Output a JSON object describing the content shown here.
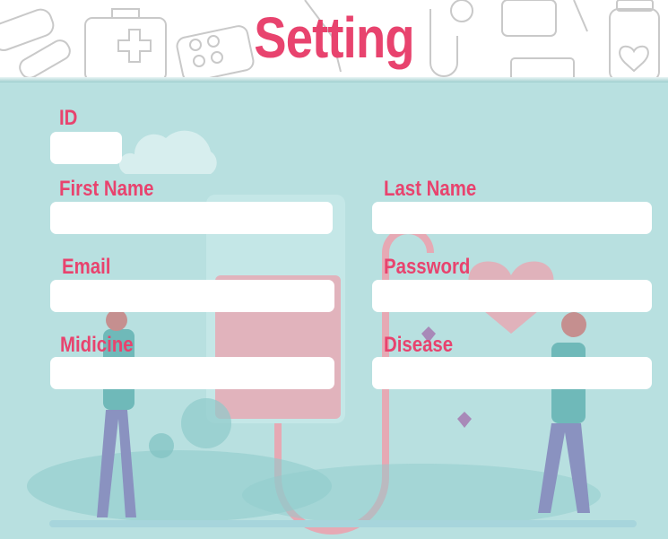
{
  "header": {
    "title": "Setting"
  },
  "form": {
    "id_label": "ID",
    "first_name_label": "First Name",
    "last_name_label": "Last Name",
    "email_label": "Email",
    "password_label": "Password",
    "medicine_label": "Midicine",
    "disease_label": "Disease",
    "id_value": "",
    "first_name_value": "",
    "last_name_value": "",
    "email_value": "",
    "password_value": "",
    "medicine_value": "",
    "disease_value": ""
  },
  "colors": {
    "accent": "#e8436e",
    "background": "#b8e0e0",
    "header_bg": "#ffffff"
  }
}
